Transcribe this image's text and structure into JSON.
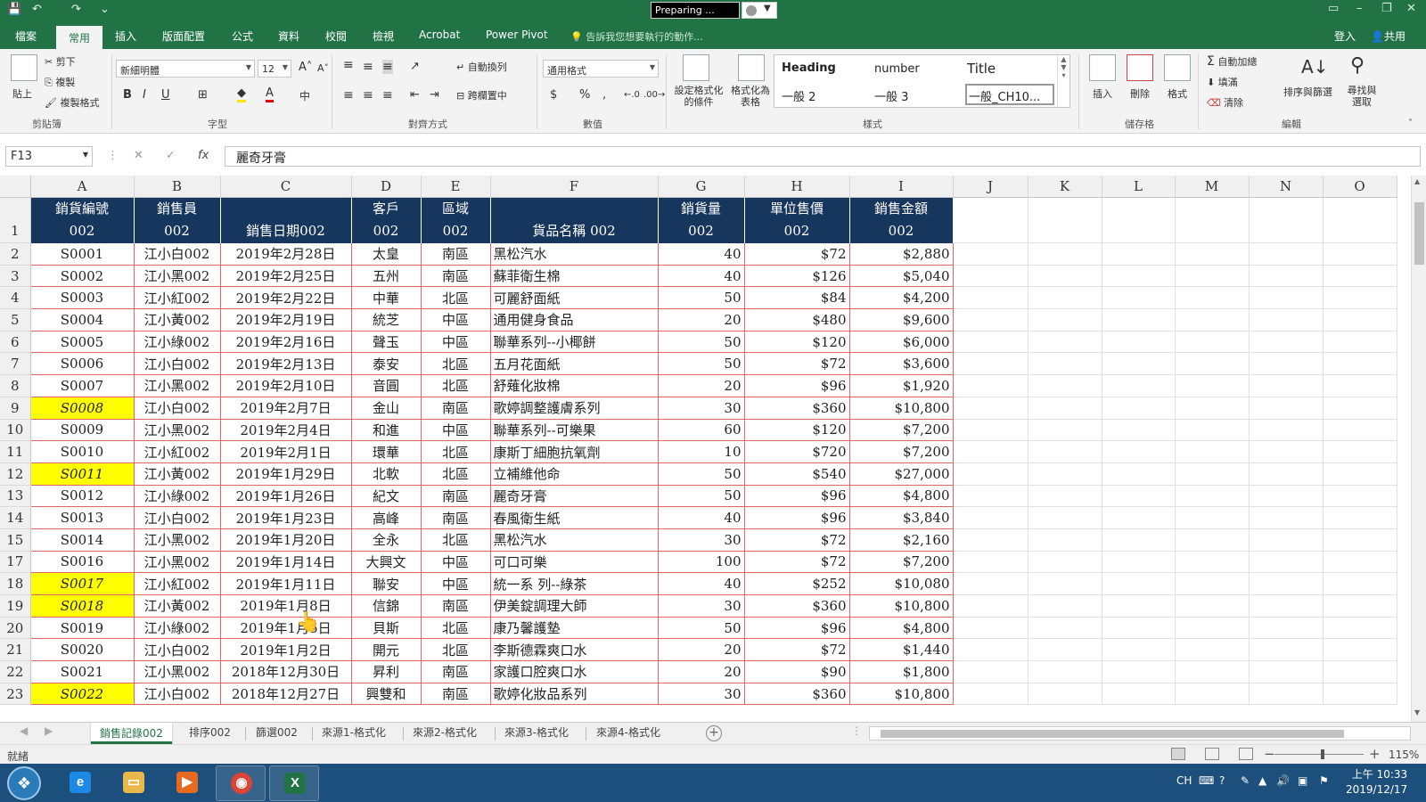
{
  "titlebar": {
    "status_text": "Preparing ..."
  },
  "ribbon_tabs": [
    "檔案",
    "常用",
    "插入",
    "版面配置",
    "公式",
    "資料",
    "校閱",
    "檢視",
    "Acrobat",
    "Power Pivot"
  ],
  "tell_me": "告訴我您想要執行的動作...",
  "account": {
    "signin": "登入",
    "share": "共用"
  },
  "ribbon": {
    "clipboard": {
      "paste": "貼上",
      "cut": "剪下",
      "copy": "複製",
      "format_painter": "複製格式",
      "label": "剪貼簿"
    },
    "font": {
      "name": "新細明體",
      "size": "12",
      "label": "字型",
      "bold": "B",
      "italic": "I",
      "underline": "U"
    },
    "alignment": {
      "wrap": "自動換列",
      "merge": "跨欄置中",
      "label": "對齊方式"
    },
    "number": {
      "format": "通用格式",
      "label": "數值",
      "currency": "$",
      "percent": "%",
      "comma": ","
    },
    "styles": {
      "conditional": "設定格式化的條件",
      "as_table": "格式化為表格",
      "items": [
        "Heading",
        "number",
        "Title",
        "一般 2",
        "一般 3",
        "一般_CH10..."
      ],
      "label": "樣式"
    },
    "cells": {
      "insert": "插入",
      "delete": "刪除",
      "format": "格式",
      "label": "儲存格"
    },
    "editing": {
      "autosum": "自動加總",
      "fill": "填滿",
      "clear": "清除",
      "sort": "排序與篩選",
      "find": "尋找與選取",
      "label": "編輯"
    }
  },
  "formula_bar": {
    "name_box": "F13",
    "cancel": "✕",
    "enter": "✓",
    "fx": "fx",
    "value": "麗奇牙膏"
  },
  "columns": [
    "A",
    "B",
    "C",
    "D",
    "E",
    "F",
    "G",
    "H",
    "I",
    "J",
    "K",
    "L",
    "M",
    "N",
    "O"
  ],
  "header_row": {
    "row_num": "1",
    "cells": [
      [
        "銷貨編號",
        "002"
      ],
      [
        "銷售員",
        "002"
      ],
      [
        "",
        "銷售日期002"
      ],
      [
        "客戶",
        "002"
      ],
      [
        "區域",
        "002"
      ],
      [
        "",
        "貨品名稱 002"
      ],
      [
        "銷貨量",
        "002"
      ],
      [
        "單位售價",
        "002"
      ],
      [
        "銷售金額",
        "002"
      ]
    ]
  },
  "rows": [
    {
      "n": "2",
      "id": "S0001",
      "rep": "江小白002",
      "date": "2019年2月28日",
      "cust": "太皇",
      "region": "南區",
      "item": "黑松汽水",
      "qty": "40",
      "price": "$72",
      "amount": "$2,880",
      "hl": false
    },
    {
      "n": "3",
      "id": "S0002",
      "rep": "江小黑002",
      "date": "2019年2月25日",
      "cust": "五州",
      "region": "南區",
      "item": "蘇菲衛生棉",
      "qty": "40",
      "price": "$126",
      "amount": "$5,040",
      "hl": false
    },
    {
      "n": "4",
      "id": "S0003",
      "rep": "江小紅002",
      "date": "2019年2月22日",
      "cust": "中華",
      "region": "北區",
      "item": "可麗舒面紙",
      "qty": "50",
      "price": "$84",
      "amount": "$4,200",
      "hl": false
    },
    {
      "n": "5",
      "id": "S0004",
      "rep": "江小黃002",
      "date": "2019年2月19日",
      "cust": "統芝",
      "region": "中區",
      "item": "通用健身食品",
      "qty": "20",
      "price": "$480",
      "amount": "$9,600",
      "hl": false
    },
    {
      "n": "6",
      "id": "S0005",
      "rep": "江小綠002",
      "date": "2019年2月16日",
      "cust": "聲玉",
      "region": "中區",
      "item": "聯華系列--小椰餅",
      "qty": "50",
      "price": "$120",
      "amount": "$6,000",
      "hl": false
    },
    {
      "n": "7",
      "id": "S0006",
      "rep": "江小白002",
      "date": "2019年2月13日",
      "cust": "泰安",
      "region": "北區",
      "item": "五月花面紙",
      "qty": "50",
      "price": "$72",
      "amount": "$3,600",
      "hl": false
    },
    {
      "n": "8",
      "id": "S0007",
      "rep": "江小黑002",
      "date": "2019年2月10日",
      "cust": "音圓",
      "region": "北區",
      "item": "舒薙化妝棉",
      "qty": "20",
      "price": "$96",
      "amount": "$1,920",
      "hl": false
    },
    {
      "n": "9",
      "id": "S0008",
      "rep": "江小白002",
      "date": "2019年2月7日",
      "cust": "金山",
      "region": "南區",
      "item": "歌婷調整護膚系列",
      "qty": "30",
      "price": "$360",
      "amount": "$10,800",
      "hl": true
    },
    {
      "n": "10",
      "id": "S0009",
      "rep": "江小黑002",
      "date": "2019年2月4日",
      "cust": "和進",
      "region": "中區",
      "item": "聯華系列--可樂果",
      "qty": "60",
      "price": "$120",
      "amount": "$7,200",
      "hl": false
    },
    {
      "n": "11",
      "id": "S0010",
      "rep": "江小紅002",
      "date": "2019年2月1日",
      "cust": "環華",
      "region": "北區",
      "item": "康斯丁細胞抗氧劑",
      "qty": "10",
      "price": "$720",
      "amount": "$7,200",
      "hl": false
    },
    {
      "n": "12",
      "id": "S0011",
      "rep": "江小黃002",
      "date": "2019年1月29日",
      "cust": "北軟",
      "region": "北區",
      "item": "立補維他命",
      "qty": "50",
      "price": "$540",
      "amount": "$27,000",
      "hl": true
    },
    {
      "n": "13",
      "id": "S0012",
      "rep": "江小綠002",
      "date": "2019年1月26日",
      "cust": "紀文",
      "region": "南區",
      "item": "麗奇牙膏",
      "qty": "50",
      "price": "$96",
      "amount": "$4,800",
      "hl": false
    },
    {
      "n": "14",
      "id": "S0013",
      "rep": "江小白002",
      "date": "2019年1月23日",
      "cust": "高峰",
      "region": "南區",
      "item": "春風衛生紙",
      "qty": "40",
      "price": "$96",
      "amount": "$3,840",
      "hl": false
    },
    {
      "n": "15",
      "id": "S0014",
      "rep": "江小黑002",
      "date": "2019年1月20日",
      "cust": "全永",
      "region": "北區",
      "item": "黑松汽水",
      "qty": "30",
      "price": "$72",
      "amount": "$2,160",
      "hl": false
    },
    {
      "n": "17",
      "id": "S0016",
      "rep": "江小黑002",
      "date": "2019年1月14日",
      "cust": "大興文",
      "region": "中區",
      "item": "可口可樂",
      "qty": "100",
      "price": "$72",
      "amount": "$7,200",
      "hl": false
    },
    {
      "n": "18",
      "id": "S0017",
      "rep": "江小紅002",
      "date": "2019年1月11日",
      "cust": "聯安",
      "region": "中區",
      "item": "統一系 列--綠茶",
      "qty": "40",
      "price": "$252",
      "amount": "$10,080",
      "hl": true
    },
    {
      "n": "19",
      "id": "S0018",
      "rep": "江小黃002",
      "date": "2019年1月8日",
      "cust": "信錦",
      "region": "南區",
      "item": "伊美錠調理大師",
      "qty": "30",
      "price": "$360",
      "amount": "$10,800",
      "hl": true
    },
    {
      "n": "20",
      "id": "S0019",
      "rep": "江小綠002",
      "date": "2019年1月5日",
      "cust": "貝斯",
      "region": "北區",
      "item": "康乃馨護墊",
      "qty": "50",
      "price": "$96",
      "amount": "$4,800",
      "hl": false
    },
    {
      "n": "21",
      "id": "S0020",
      "rep": "江小白002",
      "date": "2019年1月2日",
      "cust": "開元",
      "region": "北區",
      "item": "李斯德霖爽口水",
      "qty": "20",
      "price": "$72",
      "amount": "$1,440",
      "hl": false
    },
    {
      "n": "22",
      "id": "S0021",
      "rep": "江小黑002",
      "date": "2018年12月30日",
      "cust": "昇利",
      "region": "南區",
      "item": "家護口腔爽口水",
      "qty": "20",
      "price": "$90",
      "amount": "$1,800",
      "hl": false
    },
    {
      "n": "23",
      "id": "S0022",
      "rep": "江小白002",
      "date": "2018年12月27日",
      "cust": "興雙和",
      "region": "南區",
      "item": "歌婷化妝品系列",
      "qty": "30",
      "price": "$360",
      "amount": "$10,800",
      "hl": true
    }
  ],
  "sheet_tabs": [
    "銷售記錄002",
    "排序002",
    "篩選002",
    "來源1-格式化",
    "來源2-格式化",
    "來源3-格式化",
    "來源4-格式化"
  ],
  "status": {
    "text": "就緒",
    "zoom": "115%"
  },
  "taskbar": {
    "ime": "CH",
    "time": "上午 10:33",
    "date": "2019/12/17"
  }
}
